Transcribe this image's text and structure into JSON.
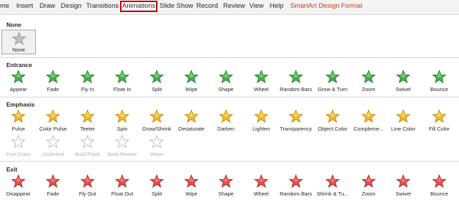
{
  "ribbon": {
    "tabs": [
      {
        "label": "me",
        "active": false,
        "contextual": false
      },
      {
        "label": "Insert",
        "active": false,
        "contextual": false
      },
      {
        "label": "Draw",
        "active": false,
        "contextual": false
      },
      {
        "label": "Design",
        "active": false,
        "contextual": false
      },
      {
        "label": "Transitions",
        "active": false,
        "contextual": false
      },
      {
        "label": "Animations",
        "active": true,
        "contextual": false
      },
      {
        "label": "Slide Show",
        "active": false,
        "contextual": false
      },
      {
        "label": "Record",
        "active": false,
        "contextual": false
      },
      {
        "label": "Review",
        "active": false,
        "contextual": false
      },
      {
        "label": "View",
        "active": false,
        "contextual": false
      },
      {
        "label": "Help",
        "active": false,
        "contextual": false
      },
      {
        "label": "SmartArt Design",
        "active": false,
        "contextual": true
      },
      {
        "label": "Format",
        "active": false,
        "contextual": true
      }
    ]
  },
  "colors": {
    "none": "#a6a6a6",
    "entrance": "#4caf50",
    "emphasis": "#f5b731",
    "exit": "#e05252",
    "disabled": "#c8c8c8",
    "selected_tab_border": "#c00000",
    "contextual_tab": "#c0421c"
  },
  "sections": {
    "none": {
      "title": "None",
      "items": [
        {
          "label": "None",
          "icon": "star-gray-icon"
        }
      ]
    },
    "entrance": {
      "title": "Entrance",
      "items": [
        {
          "label": "Appear",
          "icon": "star-green-icon"
        },
        {
          "label": "Fade",
          "icon": "star-green-icon"
        },
        {
          "label": "Fly In",
          "icon": "star-green-icon"
        },
        {
          "label": "Float In",
          "icon": "star-green-icon"
        },
        {
          "label": "Split",
          "icon": "star-green-icon"
        },
        {
          "label": "Wipe",
          "icon": "star-green-icon"
        },
        {
          "label": "Shape",
          "icon": "star-green-icon"
        },
        {
          "label": "Wheel",
          "icon": "star-green-icon"
        },
        {
          "label": "Random Bars",
          "icon": "star-green-icon"
        },
        {
          "label": "Grow & Turn",
          "icon": "star-green-icon"
        },
        {
          "label": "Zoom",
          "icon": "star-green-icon"
        },
        {
          "label": "Swivel",
          "icon": "star-green-icon"
        },
        {
          "label": "Bounce",
          "icon": "star-green-icon"
        }
      ]
    },
    "emphasis": {
      "title": "Emphasis",
      "items": [
        {
          "label": "Pulse",
          "icon": "star-gold-icon"
        },
        {
          "label": "Color Pulse",
          "icon": "star-gold-icon"
        },
        {
          "label": "Teeter",
          "icon": "star-gold-icon"
        },
        {
          "label": "Spin",
          "icon": "star-gold-icon"
        },
        {
          "label": "Grow/Shrink",
          "icon": "star-gold-icon"
        },
        {
          "label": "Desaturate",
          "icon": "star-gold-icon"
        },
        {
          "label": "Darken",
          "icon": "star-gold-icon"
        },
        {
          "label": "Lighten",
          "icon": "star-gold-icon"
        },
        {
          "label": "Transparency",
          "icon": "star-gold-icon"
        },
        {
          "label": "Object Color",
          "icon": "star-gold-icon"
        },
        {
          "label": "Compleme...",
          "icon": "star-gold-icon"
        },
        {
          "label": "Line Color",
          "icon": "star-gold-icon"
        },
        {
          "label": "Fill Color",
          "icon": "star-gold-icon"
        },
        {
          "label": "Font Color",
          "icon": "star-gray-icon",
          "disabled": true
        },
        {
          "label": "Underline",
          "icon": "star-gray-icon",
          "disabled": true
        },
        {
          "label": "Bold Flash",
          "icon": "star-gray-icon",
          "disabled": true
        },
        {
          "label": "Bold Reveal",
          "icon": "star-gray-icon",
          "disabled": true
        },
        {
          "label": "Wave",
          "icon": "star-gray-icon",
          "disabled": true
        }
      ]
    },
    "exit": {
      "title": "Exit",
      "items": [
        {
          "label": "Disappear",
          "icon": "star-red-icon"
        },
        {
          "label": "Fade",
          "icon": "star-red-icon"
        },
        {
          "label": "Fly Out",
          "icon": "star-red-icon"
        },
        {
          "label": "Float Out",
          "icon": "star-red-icon"
        },
        {
          "label": "Split",
          "icon": "star-red-icon"
        },
        {
          "label": "Wipe",
          "icon": "star-red-icon"
        },
        {
          "label": "Shape",
          "icon": "star-red-icon"
        },
        {
          "label": "Wheel",
          "icon": "star-red-icon"
        },
        {
          "label": "Random Bars",
          "icon": "star-red-icon"
        },
        {
          "label": "Shrink & Tu...",
          "icon": "star-red-icon"
        },
        {
          "label": "Zoom",
          "icon": "star-red-icon"
        },
        {
          "label": "Swivel",
          "icon": "star-red-icon"
        },
        {
          "label": "Bounce",
          "icon": "star-red-icon"
        }
      ]
    }
  }
}
